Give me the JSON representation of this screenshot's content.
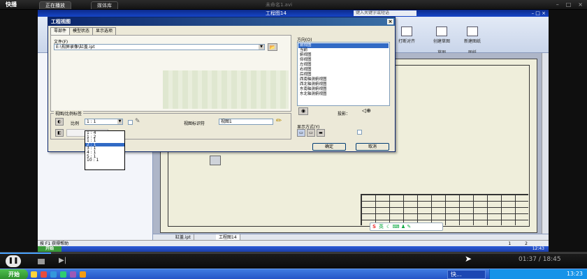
{
  "player": {
    "logo": "快播",
    "tabs": [
      "正在播放",
      "媒体库"
    ],
    "file_title": "未命名1.avi",
    "window_buttons": [
      "–",
      "□",
      "×"
    ],
    "time_readout": "01:37 / 18:45",
    "progress_fraction": 0.087
  },
  "inventor": {
    "title": "工程图14",
    "help_placeholder": "键入关键字或短语",
    "ribbon_buttons": [
      "打断对齐",
      "创建草图",
      "新建图纸"
    ],
    "ribbon_groups": [
      "草图",
      "图纸"
    ],
    "bottom_tabs": [
      "缸盖.ipt",
      "工程图14"
    ],
    "status_text": "按 F1 获得帮助",
    "status_numbers": [
      "1",
      "2"
    ],
    "inner_start": "开始",
    "inner_clock": "12:43"
  },
  "dialog": {
    "title": "工程视图",
    "tabs": [
      "零部件",
      "模型状态",
      "显示选项"
    ],
    "file_label": "文件(F)",
    "file_value": "E:\\视屏录像\\缸盖.ipt",
    "orientation_label": "方向(O)",
    "orientations": [
      "前视图",
      "当前",
      "俯视图",
      "仰视图",
      "左视图",
      "右视图",
      "后视图",
      "西南轴测俯视图",
      "西北轴测俯视图",
      "东南轴测俯视图",
      "东北轴测俯视图"
    ],
    "projection_label": "投影：",
    "style_label": "显示方式(Y)",
    "scale_group_label": "视图/比例标签",
    "scale_label": "比例",
    "scale_value": "1 : 1",
    "view_id_label": "视图标识符",
    "view_id_value": "视图1",
    "ok_label": "确定",
    "cancel_label": "取消",
    "scale_options": [
      "1 : 4",
      "1 : 2",
      "1 : 1",
      "2 : 1",
      "3 : 1",
      "4 : 1",
      "5 : 1",
      "10 : 1"
    ]
  },
  "ime": {
    "logo": "S",
    "lang": "英"
  },
  "os": {
    "start": "开始",
    "task_item": "快...",
    "clock": "13:23"
  },
  "colors": {
    "titlebar": "#0a246a",
    "selection": "#316ac5",
    "sheet": "#efeedb",
    "taskbar": "#2455c8"
  }
}
